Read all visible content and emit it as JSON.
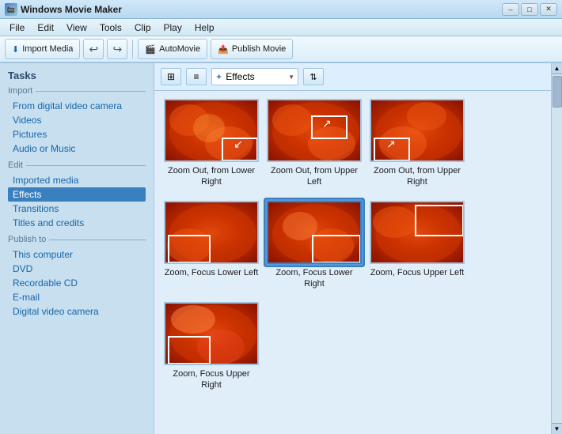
{
  "window": {
    "title": "Windows Movie Maker",
    "icon": "🎬",
    "controls": [
      "–",
      "□",
      "✕"
    ]
  },
  "menu": {
    "items": [
      "File",
      "Edit",
      "View",
      "Tools",
      "Clip",
      "Play",
      "Help"
    ]
  },
  "toolbar": {
    "import_label": "Import Media",
    "undo_icon": "↩",
    "redo_icon": "↪",
    "automovie_label": "AutoMovie",
    "publish_label": "Publish Movie"
  },
  "sidebar": {
    "sections": [
      {
        "label": "Import",
        "links": [
          {
            "text": "From digital video camera",
            "id": "from-dv"
          },
          {
            "text": "Videos",
            "id": "videos"
          },
          {
            "text": "Pictures",
            "id": "pictures"
          },
          {
            "text": "Audio or Music",
            "id": "audio"
          }
        ]
      },
      {
        "label": "Edit",
        "links": [
          {
            "text": "Imported media",
            "id": "imported-media"
          },
          {
            "text": "Effects",
            "id": "effects",
            "selected": true
          },
          {
            "text": "Transitions",
            "id": "transitions"
          },
          {
            "text": "Titles and credits",
            "id": "titles"
          }
        ]
      },
      {
        "label": "Publish to",
        "links": [
          {
            "text": "This computer",
            "id": "this-computer"
          },
          {
            "text": "DVD",
            "id": "dvd"
          },
          {
            "text": "Recordable CD",
            "id": "recordable-cd"
          },
          {
            "text": "E-mail",
            "id": "email"
          },
          {
            "text": "Digital video camera",
            "id": "digital-video"
          }
        ]
      }
    ]
  },
  "effects_toolbar": {
    "view_icons": [
      "grid",
      "list"
    ],
    "dropdown_label": "Effects",
    "sort_icon": "⇅"
  },
  "effects": [
    {
      "id": "zoom-out-lower-right",
      "label": "Zoom Out, from Lower Right",
      "zoom_from": "lower-right",
      "selected": false
    },
    {
      "id": "zoom-out-upper-left",
      "label": "Zoom Out, from Upper Left",
      "zoom_from": "upper-left",
      "selected": false
    },
    {
      "id": "zoom-out-upper-right",
      "label": "Zoom Out, from Upper Right",
      "zoom_from": "upper-right",
      "selected": false
    },
    {
      "id": "zoom-focus-lower-left",
      "label": "Zoom, Focus Lower Left",
      "zoom_from": "focus-lower-left",
      "selected": false
    },
    {
      "id": "zoom-focus-lower-right",
      "label": "Zoom, Focus Lower Right",
      "zoom_from": "focus-lower-right",
      "selected": true
    },
    {
      "id": "zoom-focus-upper-left",
      "label": "Zoom, Focus Upper Left",
      "zoom_from": "focus-upper-left",
      "selected": false
    },
    {
      "id": "zoom-focus-upper-right",
      "label": "Zoom, Focus Upper Right",
      "zoom_from": "focus-upper-right",
      "selected": false
    }
  ]
}
